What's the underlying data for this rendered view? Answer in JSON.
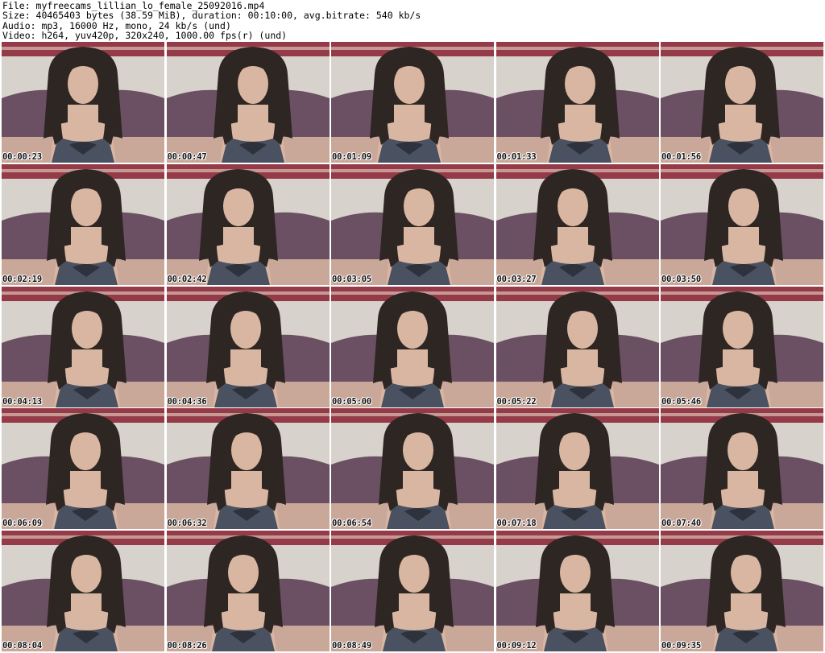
{
  "header": {
    "file": "File: myfreecams_lillian_lo_female_25092016.mp4",
    "size": "Size: 40465403 bytes (38.59 MiB), duration: 00:10:00, avg.bitrate: 540 kb/s",
    "audio": "Audio: mp3, 16000 Hz, mono, 24 kb/s (und)",
    "video": "Video: h264, yuv420p, 320x240, 1000.00 fps(r) (und)"
  },
  "thumbnails": [
    {
      "timestamp": "00:00:23"
    },
    {
      "timestamp": "00:00:47"
    },
    {
      "timestamp": "00:01:09"
    },
    {
      "timestamp": "00:01:33"
    },
    {
      "timestamp": "00:01:56"
    },
    {
      "timestamp": "00:02:19"
    },
    {
      "timestamp": "00:02:42"
    },
    {
      "timestamp": "00:03:05"
    },
    {
      "timestamp": "00:03:27"
    },
    {
      "timestamp": "00:03:50"
    },
    {
      "timestamp": "00:04:13"
    },
    {
      "timestamp": "00:04:36"
    },
    {
      "timestamp": "00:05:00"
    },
    {
      "timestamp": "00:05:22"
    },
    {
      "timestamp": "00:05:46"
    },
    {
      "timestamp": "00:06:09"
    },
    {
      "timestamp": "00:06:32"
    },
    {
      "timestamp": "00:06:54"
    },
    {
      "timestamp": "00:07:18"
    },
    {
      "timestamp": "00:07:40"
    },
    {
      "timestamp": "00:08:04"
    },
    {
      "timestamp": "00:08:26"
    },
    {
      "timestamp": "00:08:49"
    },
    {
      "timestamp": "00:09:12"
    },
    {
      "timestamp": "00:09:35"
    }
  ],
  "colors": {
    "wall": "#d8d2cc",
    "pillow": "#6b4f63",
    "bedding": "#8a2030",
    "hair": "#2e2622",
    "skin": "#d9b6a2",
    "dress": "#4a5160"
  }
}
